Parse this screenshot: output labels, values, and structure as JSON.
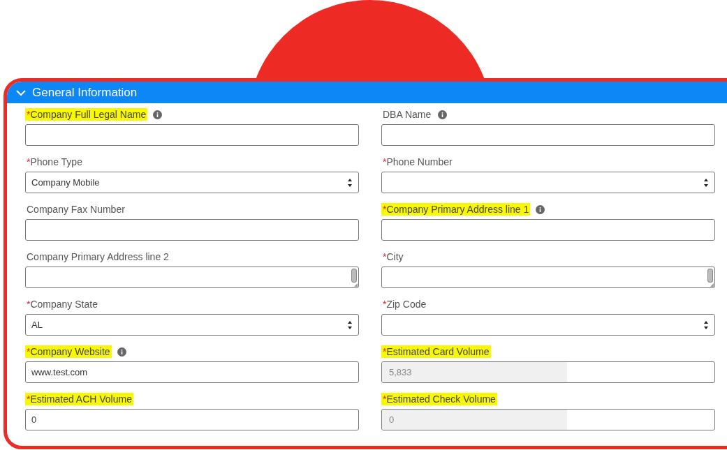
{
  "section": {
    "title": "General Information",
    "expanded": true
  },
  "fields": [
    {
      "label": "Company Full Legal Name",
      "required_mark": "*",
      "info": true,
      "highlighted": true,
      "kind": "text"
    },
    {
      "label": "DBA Name",
      "info": true,
      "highlighted": false,
      "kind": "text"
    },
    {
      "label": "Phone Type",
      "required_mark": "*",
      "info": false,
      "highlighted": false,
      "kind": "select",
      "value": "Company Mobile"
    },
    {
      "label": "Phone Number",
      "required_mark": "*",
      "info": false,
      "highlighted": false,
      "kind": "select"
    },
    {
      "label": "Company Fax Number",
      "info": false,
      "highlighted": false,
      "kind": "text"
    },
    {
      "label": "Company Primary Address line 1",
      "required_mark": "*",
      "info": true,
      "highlighted": true,
      "kind": "text"
    },
    {
      "label": "Company Primary Address line 2",
      "info": false,
      "highlighted": false,
      "kind": "textarea"
    },
    {
      "label": "City",
      "required_mark": "*",
      "info": false,
      "highlighted": false,
      "kind": "textarea"
    },
    {
      "label": "Company State",
      "required_mark": "*",
      "info": false,
      "highlighted": false,
      "kind": "select",
      "value": "AL"
    },
    {
      "label": "Zip Code",
      "required_mark": "*",
      "info": false,
      "highlighted": false,
      "kind": "select"
    },
    {
      "label": "Company Website",
      "required_mark": "*",
      "info": true,
      "highlighted": true,
      "kind": "text",
      "value": "www.test.com"
    },
    {
      "label": "Estimated Card Volume",
      "required_mark": "*",
      "info": false,
      "highlighted": true,
      "kind": "text",
      "value": "5,833",
      "disabled": true
    },
    {
      "label": "Estimated ACH Volume",
      "required_mark": "*",
      "info": false,
      "highlighted": true,
      "kind": "text",
      "value": "0"
    },
    {
      "label": "Estimated Check Volume",
      "required_mark": "*",
      "info": false,
      "highlighted": true,
      "kind": "text",
      "value": "0",
      "disabled": true
    }
  ]
}
